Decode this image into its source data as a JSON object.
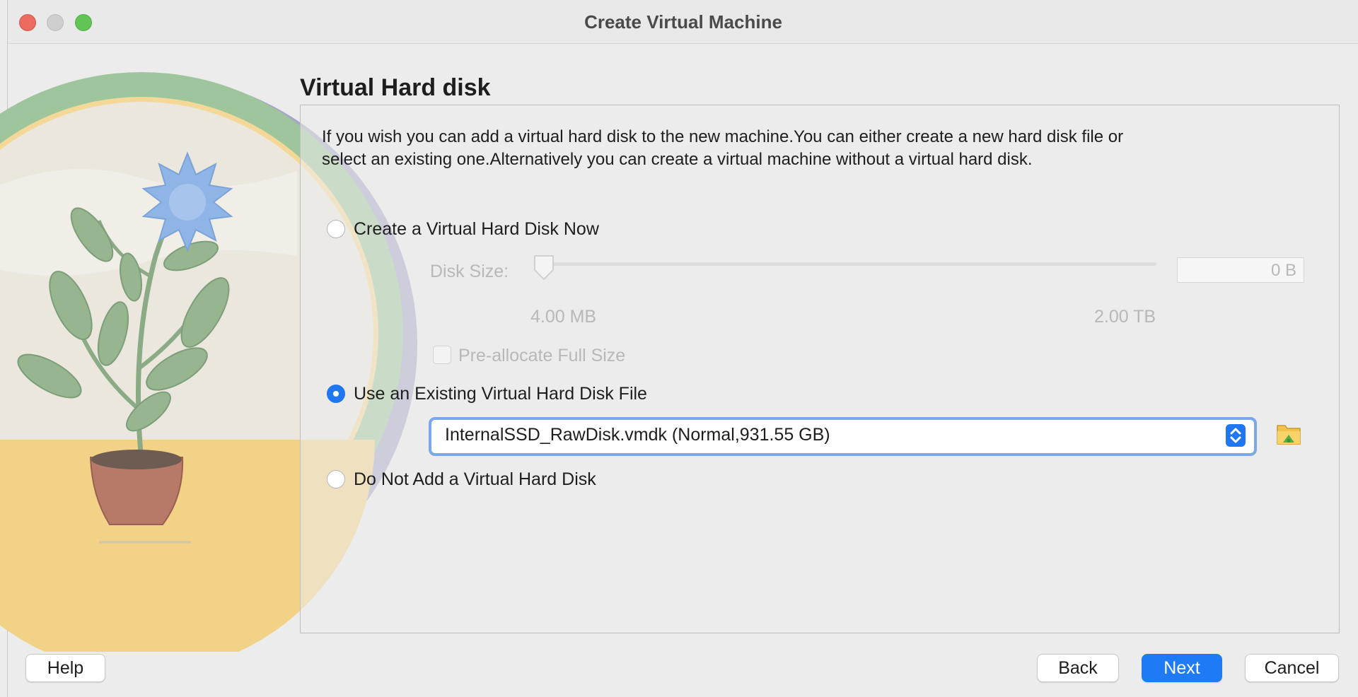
{
  "window": {
    "title": "Create Virtual Machine"
  },
  "page": {
    "title": "Virtual Hard disk",
    "description": "If you wish you can add a virtual hard disk to the new machine.You can either create a new hard disk file or select an existing one.Alternatively you can create a virtual machine without a virtual hard disk."
  },
  "options": {
    "create_now": {
      "label": "Create a Virtual Hard Disk Now",
      "selected": false
    },
    "use_existing": {
      "label": "Use an Existing Virtual Hard Disk File",
      "selected": true
    },
    "do_not_add": {
      "label": "Do Not Add a Virtual Hard Disk",
      "selected": false
    }
  },
  "disk_size": {
    "label": "Disk Size:",
    "value": "0 B",
    "min_label": "4.00 MB",
    "max_label": "2.00 TB",
    "slider_fraction": 0
  },
  "preallocate": {
    "label": "Pre-allocate Full Size",
    "checked": false
  },
  "existing_disk": {
    "selected": "InternalSSD_RawDisk.vmdk (Normal,931.55 GB)"
  },
  "buttons": {
    "help": "Help",
    "back": "Back",
    "next": "Next",
    "cancel": "Cancel"
  },
  "colors": {
    "accent": "#1f77f2",
    "disabled_text": "#b8b8b8"
  },
  "icons": {
    "folder": "folder-open-icon",
    "stepper": "chevron-up-down-icon",
    "close": "close-icon",
    "minimize": "minimize-icon",
    "maximize": "maximize-icon"
  }
}
